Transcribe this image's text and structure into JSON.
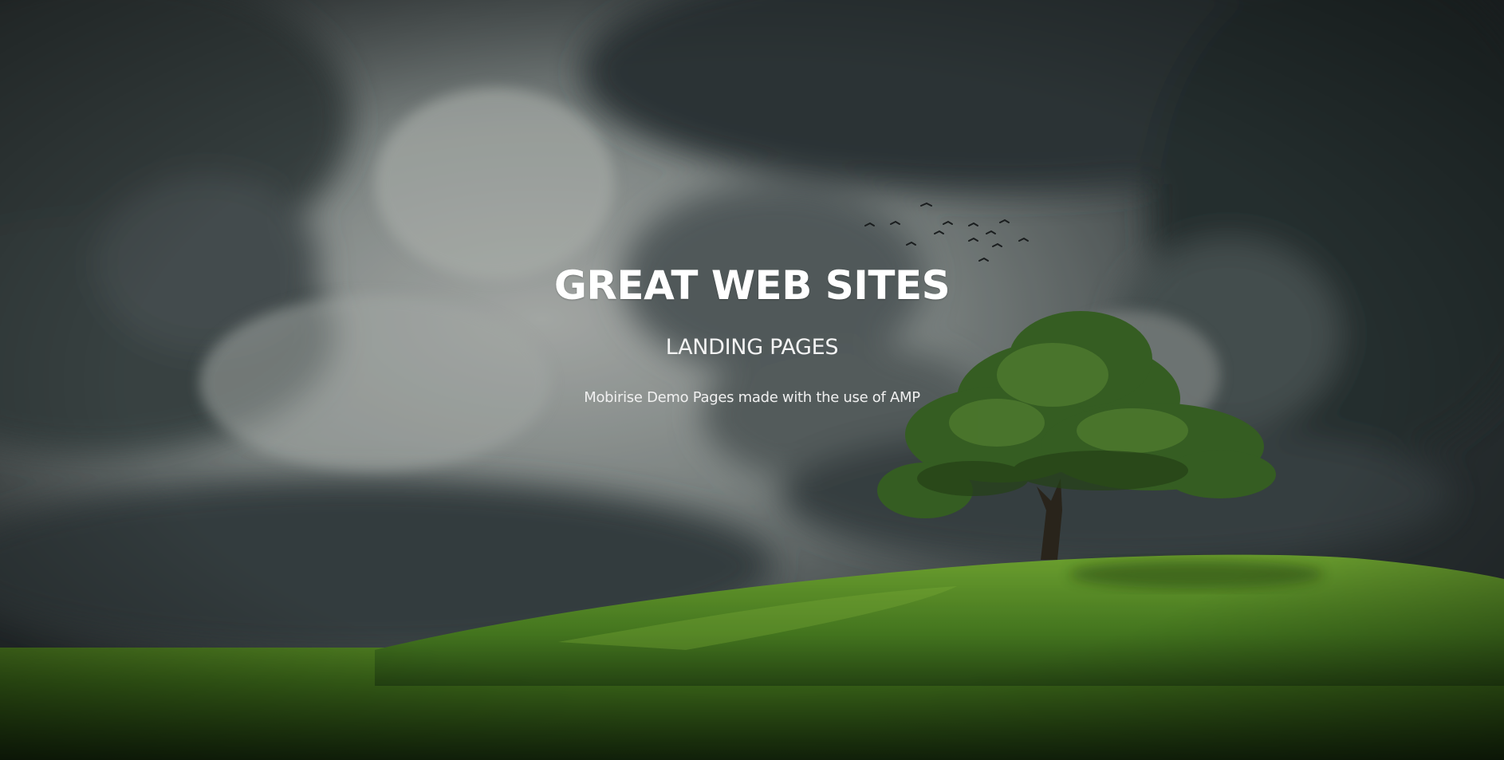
{
  "hero": {
    "title": "GREAT WEB SITES",
    "subtitle": "LANDING PAGES",
    "text": "Mobirise Demo Pages made with the use of AMP"
  },
  "background": {
    "image": "stormy-sky-green-hill-tree",
    "colors": {
      "sky_dark": "#2e3638",
      "sky_light": "#aeb3b0",
      "grass_light": "#6ca82c",
      "grass_dark": "#1f3b12",
      "tree": "#3f6b2a"
    }
  }
}
